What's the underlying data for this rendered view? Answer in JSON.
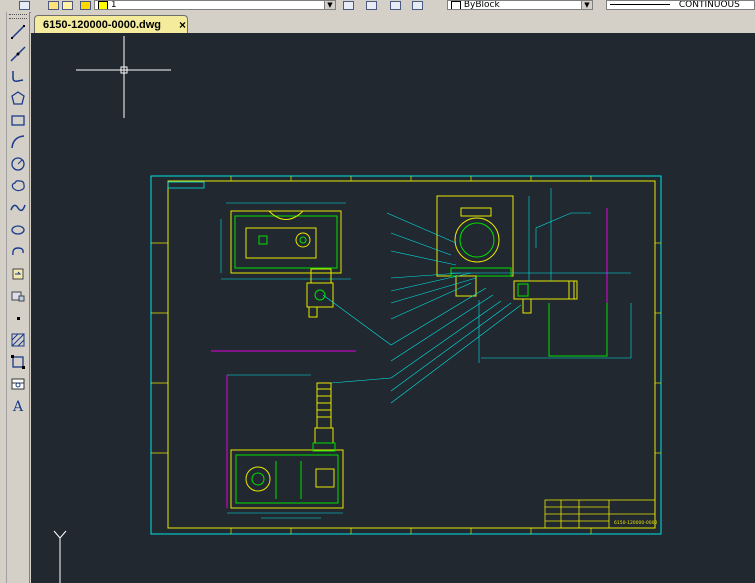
{
  "toolbar": {
    "layer_value": "1",
    "linetype_value": "ByBlock",
    "lineweight_value": "CONTINUOUS"
  },
  "tab": {
    "filename": "6150-120000-0000.dwg",
    "close_glyph": "×"
  },
  "left_toolbar": {
    "text_tool_glyph": "A"
  },
  "drawing": {
    "title_block_number": "6150-120000-0000"
  },
  "colors": {
    "canvas_background": "#212830",
    "frame": "#00e5e5",
    "inner_frame": "#e8e800",
    "parts": "#e8e800",
    "parts_highlight": "#00e000",
    "dimension": "#e000e0"
  }
}
